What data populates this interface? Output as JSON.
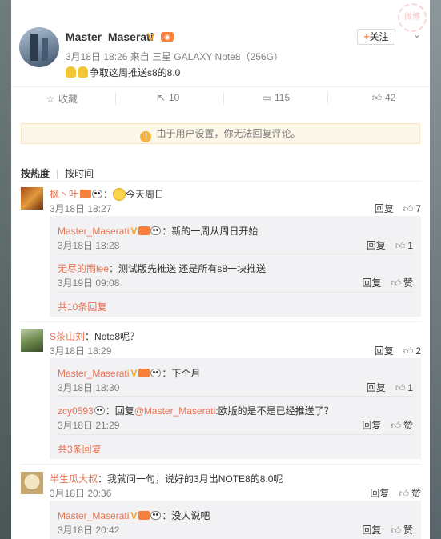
{
  "post": {
    "author": "Master_Maserati",
    "meta": "3月18日 18:26 来自 三星 GALAXY Note8（256G）",
    "content": "争取这周推送s8的8.0",
    "follow_label": "关注",
    "follow_plus": "+",
    "watermark": "微博"
  },
  "actions": {
    "favorite": "收藏",
    "repost": "10",
    "comments": "115",
    "likes": "42"
  },
  "notice": "由于用户设置，你无法回复评论。",
  "sort": {
    "hot": "按热度",
    "time": "按时间"
  },
  "comments": [
    {
      "name": "枫丶叶",
      "text": "今天周日",
      "time": "3月18日 18:27",
      "reply": "回复",
      "likes": "7",
      "replies": [
        {
          "name": "Master_Maserati",
          "text": "新的一周从周日开始",
          "time": "3月18日 18:28",
          "reply": "回复",
          "likes": "1"
        },
        {
          "name": "无尽的雨lee",
          "text": "测试版先推送 还是所有s8一块推送",
          "time": "3月19日 09:08",
          "reply": "回复",
          "likes": "赞"
        }
      ],
      "more": "共10条回复"
    },
    {
      "name": "S茶山刘",
      "text": "Note8呢？",
      "time": "3月18日 18:29",
      "reply": "回复",
      "likes": "2",
      "replies": [
        {
          "name": "Master_Maserati",
          "text": "下个月",
          "time": "3月18日 18:30",
          "reply": "回复",
          "likes": "1"
        },
        {
          "name": "zcy0593",
          "text_prefix": "回复",
          "mention": "@Master_Maserati",
          "text": ":欧版的是不是已经推送了？",
          "time": "3月18日 21:29",
          "reply": "回复",
          "likes": "赞"
        }
      ],
      "more": "共3条回复"
    },
    {
      "name": "半生瓜大叔",
      "text": "我就问一句，说好的3月出NOTE8的8.0呢",
      "time": "3月18日 20:36",
      "reply": "回复",
      "likes": "赞",
      "replies": [
        {
          "name": "Master_Maserati",
          "text": "没人说吧",
          "time": "3月18日 20:42",
          "reply": "回复",
          "likes": "赞"
        }
      ]
    }
  ],
  "colors": {
    "name": "#eb7350",
    "accent": "#ff8140",
    "muted": "#808080"
  }
}
